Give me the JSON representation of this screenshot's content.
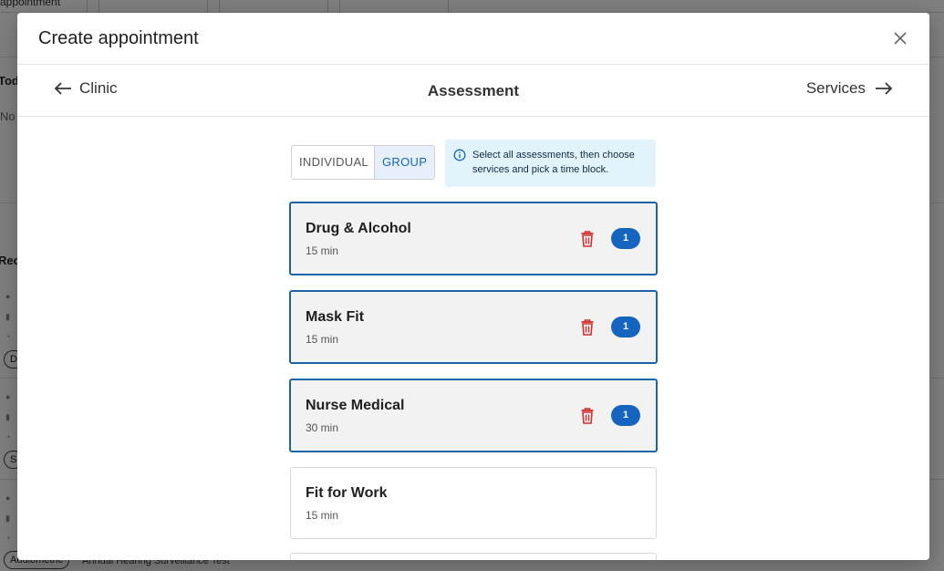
{
  "background": {
    "top_text": "appointment",
    "section_1_letters": "Tod",
    "section_1_sub": "No s",
    "section_2_letters": "Rec",
    "chip_row_1": "D",
    "chip_row_2": "S",
    "chip_row_3_a": "Audiometric",
    "chip_row_3_b": "Annual Hearing Surveillance Test"
  },
  "modal": {
    "title": "Create appointment",
    "close_icon": "close-icon"
  },
  "step_nav": {
    "back_label": "Clinic",
    "title": "Assessment",
    "next_label": "Services"
  },
  "mode_toggle": {
    "options": [
      "INDIVIDUAL",
      "GROUP"
    ],
    "selected": "GROUP"
  },
  "info": {
    "text": "Select all assessments, then choose services and pick a time block."
  },
  "assessments": [
    {
      "name": "Drug & Alcohol",
      "duration": "15 min",
      "selected": true,
      "count": "1"
    },
    {
      "name": "Mask Fit",
      "duration": "15 min",
      "selected": true,
      "count": "1"
    },
    {
      "name": "Nurse Medical",
      "duration": "30 min",
      "selected": true,
      "count": "1"
    },
    {
      "name": "Fit for Work",
      "duration": "15 min",
      "selected": false
    }
  ],
  "colors": {
    "accent": "#1565c0",
    "selected_border": "#1b64a8",
    "delete": "#d32f2f",
    "info_bg": "#e3f3fb"
  }
}
